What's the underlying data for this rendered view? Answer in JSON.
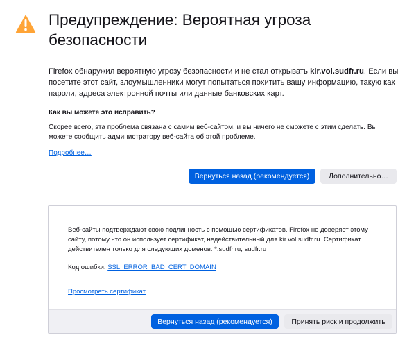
{
  "page": {
    "title": "Предупреждение: Вероятная угроза безопасности",
    "intro_before": "Firefox обнаружил вероятную угрозу безопасности и не стал открывать ",
    "intro_domain": "kir.vol.sudfr.ru",
    "intro_after": ". Если вы посетите этот сайт, злоумышленники могут попытаться похитить вашу информацию, такую как пароли, адреса электронной почты или данные банковских карт.",
    "how_title": "Как вы можете это исправить?",
    "how_text": "Скорее всего, эта проблема связана с самим веб-сайтом, и вы ничего не сможете с этим сделать. Вы можете сообщить администратору веб-сайта об этой проблеме.",
    "learn_more": "Подробнее…",
    "go_back_label": "Вернуться назад (рекомендуется)",
    "advanced_label": "Дополнительно…"
  },
  "advanced": {
    "description": "Веб-сайты подтверждают свою подлинность с помощью сертификатов. Firefox не доверяет этому сайту, потому что он использует сертификат, недействительный для kir.vol.sudfr.ru. Сертификат действителен только для следующих доменов: *.sudfr.ru, sudfr.ru",
    "error_prefix": "Код ошибки: ",
    "error_code": "SSL_ERROR_BAD_CERT_DOMAIN",
    "view_certificate": "Просмотреть сертификат",
    "go_back_label": "Вернуться назад (рекомендуется)",
    "accept_risk_label": "Принять риск и продолжить"
  },
  "colors": {
    "accent": "#0061e0",
    "warning": "#ffa436",
    "text": "#15141a",
    "footer_bg": "#f0f0f4"
  },
  "icons": {
    "warning": "warning-triangle-icon"
  }
}
